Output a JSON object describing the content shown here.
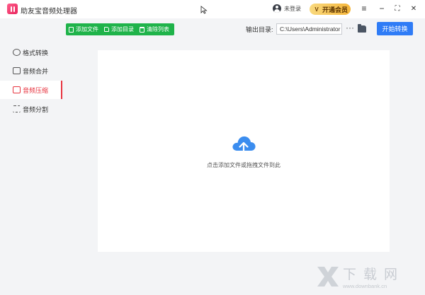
{
  "app": {
    "title": "助友宝音频处理器"
  },
  "header": {
    "login_label": "未登录",
    "vip_label": "开通会员"
  },
  "window_controls": {
    "menu": "≡",
    "minimize": "−",
    "maximize": "⛶",
    "close": "✕"
  },
  "sidebar": {
    "items": [
      {
        "label": "格式转换",
        "icon": "format-convert-icon",
        "active": false
      },
      {
        "label": "音频合并",
        "icon": "audio-merge-icon",
        "active": false
      },
      {
        "label": "音频压缩",
        "icon": "audio-compress-icon",
        "active": true
      },
      {
        "label": "音频分割",
        "icon": "audio-split-icon",
        "active": false
      }
    ]
  },
  "toolbar": {
    "add_file_label": "添加文件",
    "add_folder_label": "添加目录",
    "clear_list_label": "清除列表",
    "output_dir_label": "输出目录:",
    "output_dir_value": "C:\\Users\\Administrator",
    "more_label": "···",
    "start_label": "开始转换"
  },
  "dropzone": {
    "hint": "点击添加文件或拖拽文件到此"
  },
  "watermark": {
    "text": "下载网",
    "url": "www.downbank.cn"
  },
  "colors": {
    "accent_red": "#e7343f",
    "primary_blue": "#2f7cf6",
    "toolbar_green": "#1fb34a",
    "vip_gold": "#f5b63b",
    "cloud_blue": "#3b8def"
  }
}
